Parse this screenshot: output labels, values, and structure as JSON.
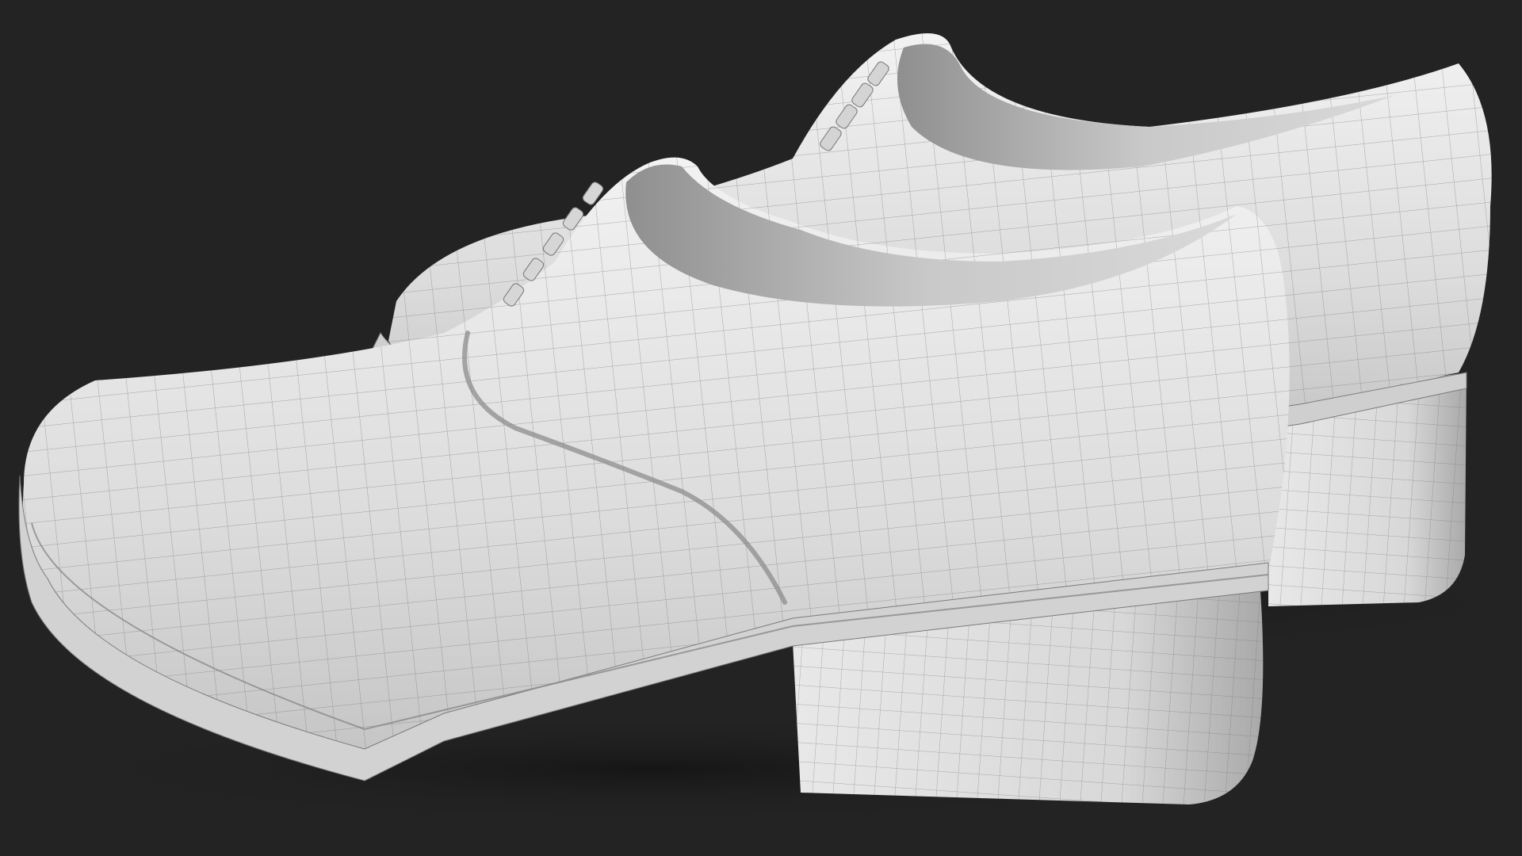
{
  "scene": {
    "subject": "pair-of-heeled-oxford-shoes",
    "render_style": "clay-wireframe",
    "colors": {
      "background": "#232323",
      "shoe_surface": "#e6e6e6",
      "shoe_shadow": "#a8a8a8",
      "interior": "#bdbdbd",
      "wire_lines": "#6f6f6f",
      "ground_shadow": "#161616"
    }
  }
}
